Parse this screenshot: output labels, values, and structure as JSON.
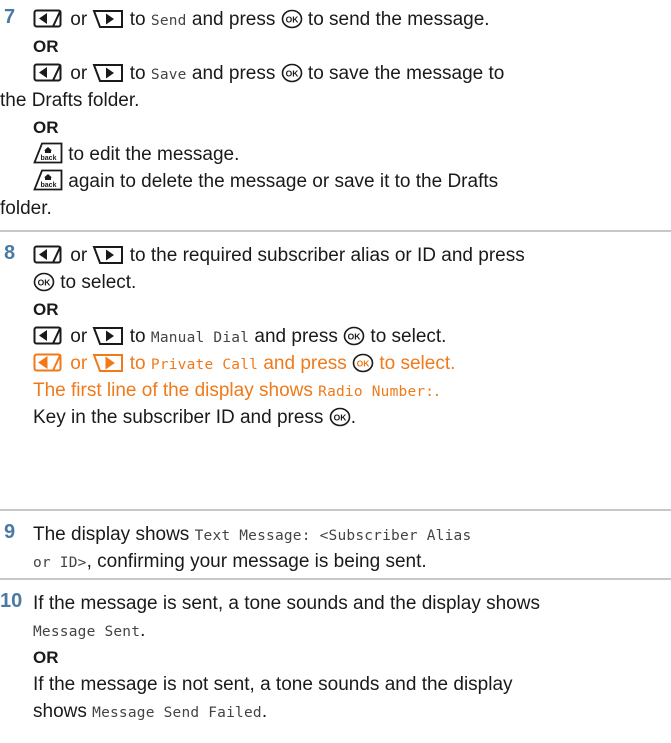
{
  "steps": [
    {
      "number": "7",
      "or_1": "or",
      "to_1": "to",
      "send_item": "Send",
      "and_press_1": "and press",
      "send_action": "to send the message.",
      "OR_1": "OR",
      "or_2": "or",
      "to_2": "to",
      "save_item": "Save",
      "and_press_2": "and press",
      "save_action": "to save the message to",
      "save_action_cont": "the Drafts folder.",
      "OR_2": "OR",
      "edit_action": "to edit the message.",
      "delete_action": "again to delete the message or save it to the Drafts",
      "delete_action_cont": "folder."
    },
    {
      "number": "8",
      "or_1": "or",
      "select_action": "to the required subscriber alias or ID and press",
      "select_action_cont": "to select.",
      "OR_1": "OR",
      "or_2": "or",
      "to_2": "to",
      "manual_item": "Manual Dial",
      "and_press_2": "and press",
      "select_2": "to select.",
      "or_3": "or",
      "to_3": "to",
      "private_item": "Private Call",
      "and_press_3": "and press",
      "select_3": "to select.",
      "first_line_text": "The first line of the display shows",
      "radio_number": "Radio Number:",
      "period": ".",
      "keyin_text": "Key in the subscriber ID and press",
      "keyin_period": "."
    },
    {
      "number": "9",
      "display_shows": "The display shows",
      "text_message_1": "Text Message: <Subscriber Alias",
      "text_message_2": "or ID>",
      "confirm_text": ", confirming your message is being sent."
    },
    {
      "number": "10",
      "sent_text": "If the message is sent, a tone sounds and the display shows",
      "message_sent": "Message Sent",
      "period": ".",
      "OR_1": "OR",
      "not_sent_text": "If the message is not sent, a tone sounds and the display",
      "shows_text": "shows",
      "send_failed": "Message Send Failed",
      "period_2": "."
    }
  ],
  "icons": {
    "left": "left-arrow-key-icon",
    "right": "right-arrow-key-icon",
    "ok": "ok-key-icon",
    "back": "back-home-key-icon"
  },
  "colors": {
    "step_number": "#4a7aa3",
    "highlight": "#f07a1a",
    "rule": "#c8c8c8"
  }
}
